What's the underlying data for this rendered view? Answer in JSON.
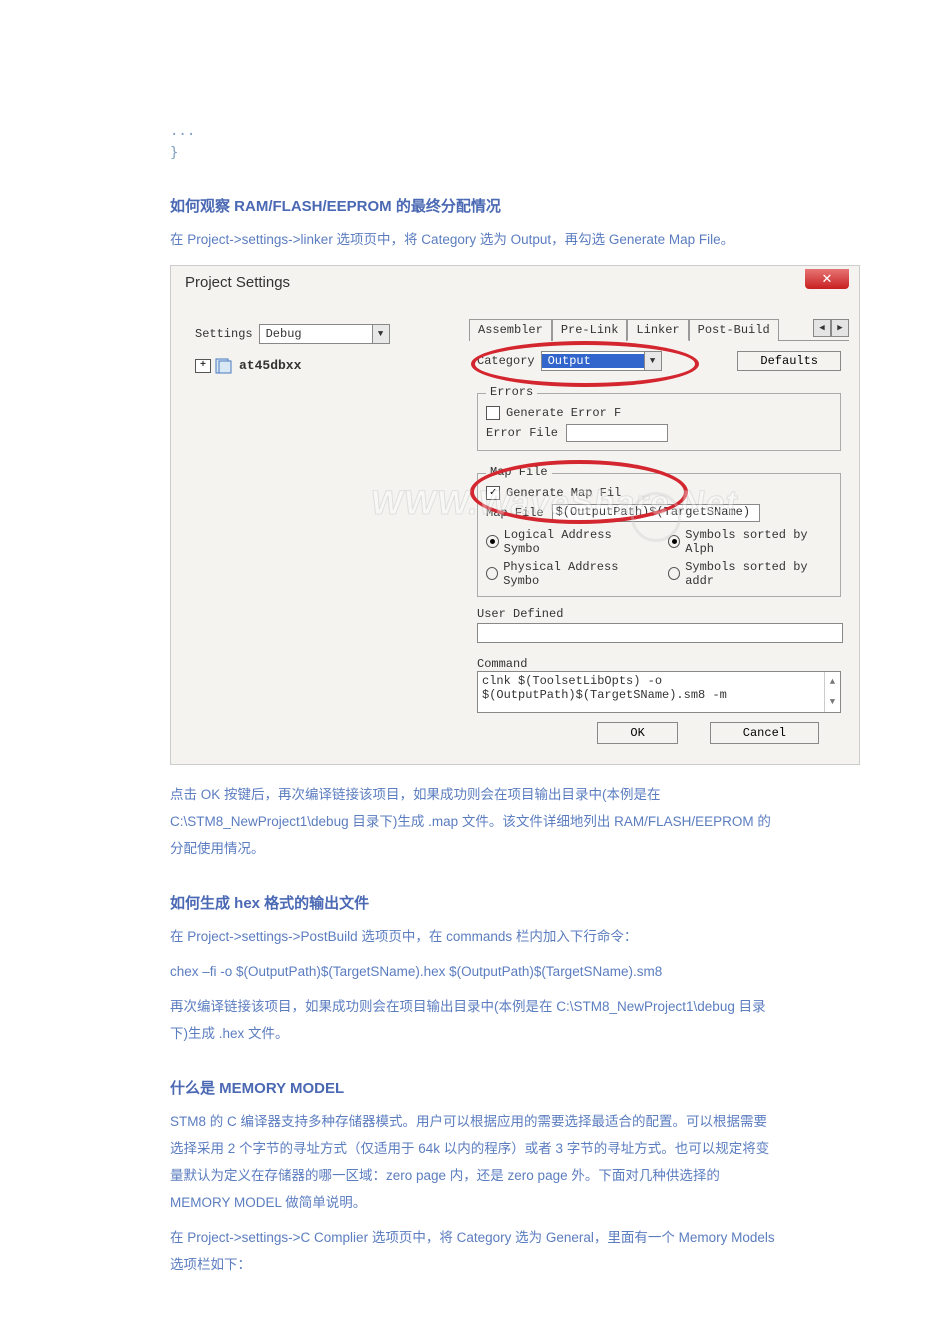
{
  "code": {
    "line1": "...",
    "line2": "}"
  },
  "section1": {
    "title": "如何观察 RAM/FLASH/EEPROM 的最终分配情况",
    "para1": "在 Project->settings->linker 选项页中，将 Category 选为 Output，再勾选 Generate Map File。"
  },
  "dialog": {
    "title": "Project Settings",
    "close": "✕",
    "settings_label": "Settings",
    "settings_value": "Debug",
    "tree_item": "at45dbxx",
    "tabs": [
      "Assembler",
      "Pre-Link",
      "Linker",
      "Post-Build"
    ],
    "category_label": "Category",
    "category_value": "Output",
    "defaults_btn": "Defaults",
    "errors_legend": "Errors",
    "gen_error_label": "Generate Error F",
    "error_file_label": "Error File",
    "map_legend": "Map File",
    "gen_map_label": "Generate Map Fil",
    "map_file_label": "Map File",
    "map_file_value": "$(OutputPath)$(TargetSName)",
    "radio1": "Logical Address Symbo",
    "radio2": "Symbols sorted by Alph",
    "radio3": "Physical Address Symbo",
    "radio4": "Symbols sorted by addr",
    "user_defined_label": "User Defined",
    "command_label": "Command",
    "command_value": "clnk $(ToolsetLibOpts) -o\n$(OutputPath)$(TargetSName).sm8 -m",
    "ok_btn": "OK",
    "cancel_btn": "Cancel",
    "watermark": "WWW.WaveShare.Net"
  },
  "after_img": {
    "p1": "点击 OK 按键后，再次编译链接该项目，如果成功则会在项目输出目录中(本例是在",
    "p2": "C:\\STM8_NewProject1\\debug 目录下)生成 .map 文件。该文件详细地列出 RAM/FLASH/EEPROM 的分配使用情况。"
  },
  "section2": {
    "title": "如何生成 hex 格式的输出文件",
    "p1": "在 Project->settings->PostBuild 选项页中，在 commands 栏内加入下行命令：",
    "p2": "chex –fi -o $(OutputPath)$(TargetSName).hex $(OutputPath)$(TargetSName).sm8",
    "p3": "再次编译链接该项目，如果成功则会在项目输出目录中(本例是在 C:\\STM8_NewProject1\\debug  目录下)生成 .hex 文件。"
  },
  "section3": {
    "title": "什么是 MEMORY MODEL",
    "p1": "STM8 的 C 编译器支持多种存储器模式。用户可以根据应用的需要选择最适合的配置。可以根据需要选择采用 2 个字节的寻址方式（仅适用于 64k 以内的程序）或者 3 字节的寻址方式。也可以规定将变量默认为定义在存储器的哪一区域：zero page 内，还是 zero page  外。下面对几种供选择的 MEMORY MODEL 做简单说明。",
    "p2": "在 Project->settings->C Complier 选项页中，将 Category 选为 General，里面有一个 Memory Models  选项栏如下："
  }
}
